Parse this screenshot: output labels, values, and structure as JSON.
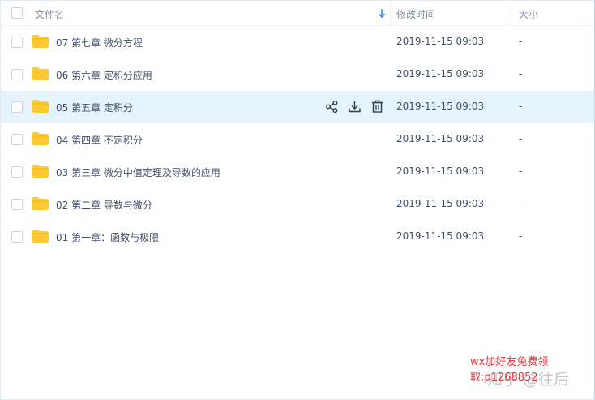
{
  "header": {
    "name_label": "文件名",
    "time_label": "修改时间",
    "size_label": "大小"
  },
  "files": [
    {
      "name": "07 第七章 微分方程",
      "time": "2019-11-15 09:03",
      "size": "-"
    },
    {
      "name": "06 第六章 定积分应用",
      "time": "2019-11-15 09:03",
      "size": "-"
    },
    {
      "name": "05 第五章 定积分",
      "time": "2019-11-15 09:03",
      "size": "-"
    },
    {
      "name": "04 第四章 不定积分",
      "time": "2019-11-15 09:03",
      "size": "-"
    },
    {
      "name": "03 第三章 微分中值定理及导数的应用",
      "time": "2019-11-15 09:03",
      "size": "-"
    },
    {
      "name": "02 第二章 导数与微分",
      "time": "2019-11-15 09:03",
      "size": "-"
    },
    {
      "name": "01 第一章：函数与极限",
      "time": "2019-11-15 09:03",
      "size": "-"
    }
  ],
  "row_actions": [
    "share-icon",
    "download-icon",
    "delete-icon"
  ],
  "colors": {
    "hover_row": "#e5f3fd",
    "folder": "#ffc933",
    "sort_arrow": "#3b8cff",
    "promo_text": "#e0363c"
  },
  "overlay": {
    "watermark": "知乎 @往后",
    "promo_line1": "wx加好友免费领",
    "promo_line2": "取:p1268852"
  }
}
